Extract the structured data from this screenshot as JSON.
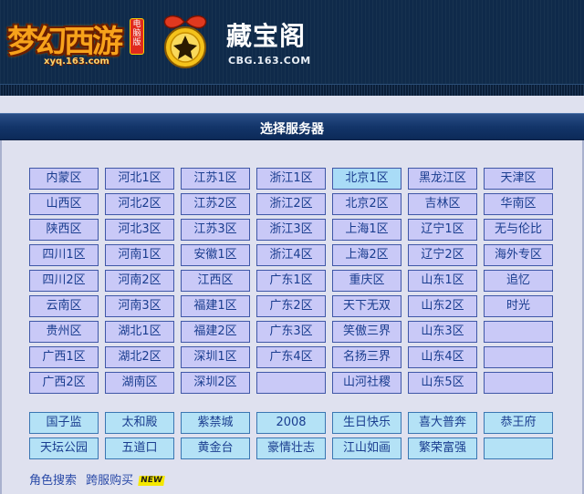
{
  "header": {
    "game_logo_text": "梦幻西游",
    "game_logo_domain": "xyq.163.com",
    "game_badge": "电脑版",
    "site_title": "藏宝阁",
    "site_domain": "CBG.163.COM"
  },
  "titlebar": {
    "label": "选择服务器"
  },
  "servers": [
    [
      "内蒙区",
      "河北1区",
      "江苏1区",
      "浙江1区",
      "北京1区",
      "黑龙江区",
      "天津区"
    ],
    [
      "山西区",
      "河北2区",
      "江苏2区",
      "浙江2区",
      "北京2区",
      "吉林区",
      "华南区"
    ],
    [
      "陕西区",
      "河北3区",
      "江苏3区",
      "浙江3区",
      "上海1区",
      "辽宁1区",
      "无与伦比"
    ],
    [
      "四川1区",
      "河南1区",
      "安徽1区",
      "浙江4区",
      "上海2区",
      "辽宁2区",
      "海外专区"
    ],
    [
      "四川2区",
      "河南2区",
      "江西区",
      "广东1区",
      "重庆区",
      "山东1区",
      "追忆"
    ],
    [
      "云南区",
      "河南3区",
      "福建1区",
      "广东2区",
      "天下无双",
      "山东2区",
      "时光"
    ],
    [
      "贵州区",
      "湖北1区",
      "福建2区",
      "广东3区",
      "笑傲三界",
      "山东3区",
      ""
    ],
    [
      "广西1区",
      "湖北2区",
      "深圳1区",
      "广东4区",
      "名扬三界",
      "山东4区",
      ""
    ],
    [
      "广西2区",
      "湖南区",
      "深圳2区",
      "",
      "山河社稷",
      "山东5区",
      ""
    ]
  ],
  "highlighted": {
    "row": 0,
    "col": 4
  },
  "special_servers": [
    [
      "国子监",
      "太和殿",
      "紫禁城",
      "2008",
      "生日快乐",
      "喜大普奔",
      "恭王府"
    ],
    [
      "天坛公园",
      "五道口",
      "黄金台",
      "豪情壮志",
      "江山如画",
      "繁荣富强",
      ""
    ]
  ],
  "links": {
    "role_search": "角色搜索",
    "cross_server": "跨服购买",
    "new_badge": "NEW"
  },
  "colors": {
    "cell_bg": "#c9c9f7",
    "cell_border": "#3f57a7",
    "cell_text": "#1a3d8f",
    "highlight_bg": "#a9dcf7",
    "special_bg": "#b4e2f6",
    "titlebar": "#13356a",
    "header_bg": "#0f2a4a"
  }
}
